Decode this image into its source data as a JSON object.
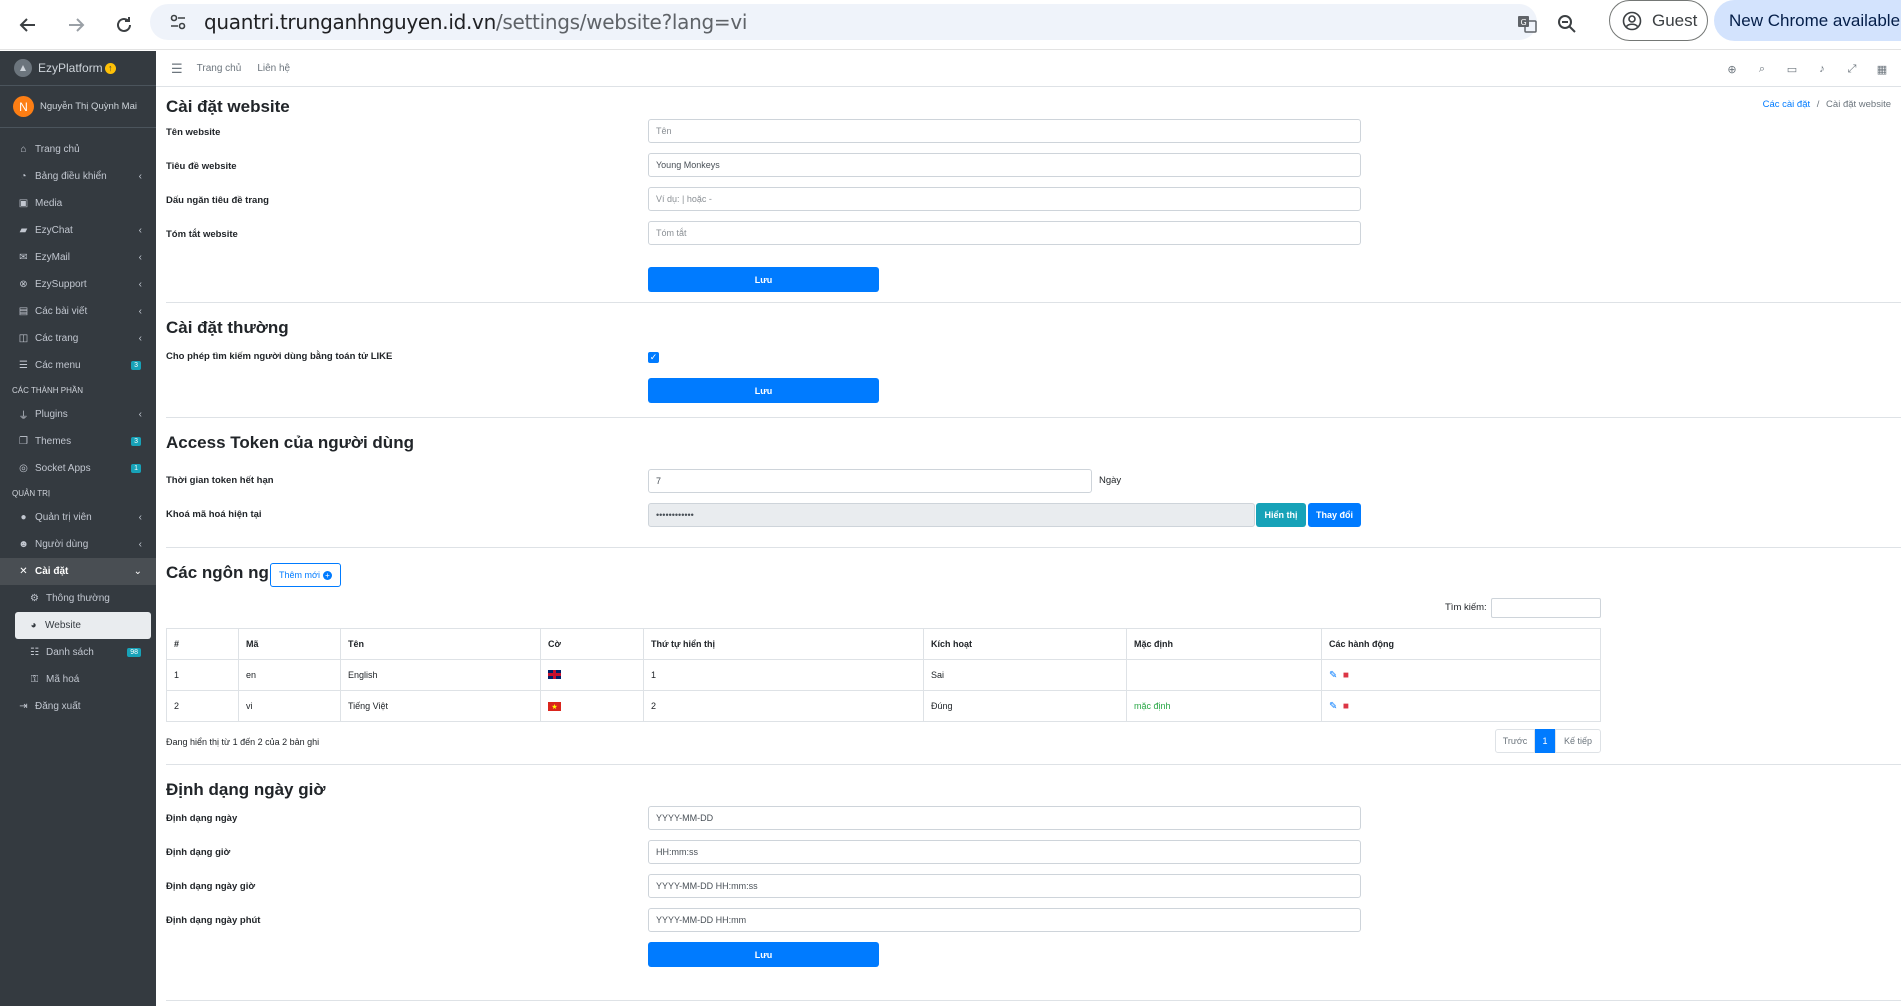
{
  "browser": {
    "url_host": "quantri.trunganhnguyen.id.vn",
    "url_path": "/settings/website?lang=vi",
    "profile_label": "Guest",
    "update_label": "New Chrome available"
  },
  "sidebar": {
    "brand": "EzyPlatform",
    "user_initial": "N",
    "user_name": "Nguyễn Thị Quỳnh Mai",
    "items": [
      {
        "label": "Trang chủ"
      },
      {
        "label": "Bảng điều khiển"
      },
      {
        "label": "Media"
      },
      {
        "label": "EzyChat"
      },
      {
        "label": "EzyMail"
      },
      {
        "label": "EzySupport"
      },
      {
        "label": "Các bài viết"
      },
      {
        "label": "Các trang"
      },
      {
        "label": "Các menu",
        "badge": "3"
      }
    ],
    "header_components": "CÁC THÀNH PHẦN",
    "components": [
      {
        "label": "Plugins"
      },
      {
        "label": "Themes",
        "badge": "3"
      },
      {
        "label": "Socket Apps",
        "badge": "1"
      }
    ],
    "header_admin": "QUẢN TRỊ",
    "admin": [
      {
        "label": "Quản trị viên"
      },
      {
        "label": "Người dùng"
      },
      {
        "label": "Cài đặt"
      }
    ],
    "settings_sub": [
      {
        "label": "Thông thường"
      },
      {
        "label": "Website"
      },
      {
        "label": "Danh sách",
        "badge": "98"
      },
      {
        "label": "Mã hoá"
      }
    ],
    "logout": "Đăng xuất"
  },
  "topnav": {
    "home": "Trang chủ",
    "contact": "Liên hệ"
  },
  "breadcrumb": {
    "parent": "Các cài đặt",
    "separator": "/",
    "current": "Cài đặt website"
  },
  "website": {
    "title": "Cài đặt website",
    "name_label": "Tên website",
    "name_placeholder": "Tên",
    "site_title_label": "Tiêu đề website",
    "site_title_value": "Young Monkeys",
    "separator_label": "Dấu ngăn tiêu đề trang",
    "separator_placeholder": "Ví dụ: | hoặc -",
    "summary_label": "Tóm tắt website",
    "summary_placeholder": "Tóm tắt",
    "save": "Lưu"
  },
  "general": {
    "title": "Cài đặt thường",
    "like_label": "Cho phép tìm kiếm người dùng bằng toán tử LIKE",
    "like_checked": true,
    "save": "Lưu"
  },
  "token": {
    "title": "Access Token của người dùng",
    "expire_label": "Thời gian token hết hạn",
    "expire_value": "7",
    "expire_unit": "Ngày",
    "key_label": "Khoá mã hoá hiện tại",
    "key_value": "••••••••••••",
    "show": "Hiển thị",
    "change": "Thay đổi"
  },
  "languages": {
    "title": "Các ngôn ngữ",
    "add_new": "Thêm mới",
    "search_label": "Tìm kiếm:",
    "columns": [
      "#",
      "Mã",
      "Tên",
      "Cờ",
      "Thứ tự hiển thị",
      "Kích hoạt",
      "Mặc định",
      "Các hành động"
    ],
    "rows": [
      {
        "no": "1",
        "code": "en",
        "name": "English",
        "flag": "gb",
        "order": "1",
        "active": "Sai",
        "default": ""
      },
      {
        "no": "2",
        "code": "vi",
        "name": "Tiếng Việt",
        "flag": "vn",
        "order": "2",
        "active": "Đúng",
        "default": "mặc định"
      }
    ],
    "info": "Đang hiển thị từ 1 đến 2 của 2 bản ghi",
    "prev": "Trước",
    "page": "1",
    "next": "Kế tiếp"
  },
  "datetime": {
    "title": "Định dạng ngày giờ",
    "date_label": "Định dạng ngày",
    "date_value": "YYYY-MM-DD",
    "time_label": "Định dạng giờ",
    "time_value": "HH:mm:ss",
    "datetime_label": "Định dạng ngày giờ",
    "datetime_value": "YYYY-MM-DD HH:mm:ss",
    "minute_label": "Định dạng ngày phút",
    "minute_value": "YYYY-MM-DD HH:mm",
    "save": "Lưu"
  }
}
